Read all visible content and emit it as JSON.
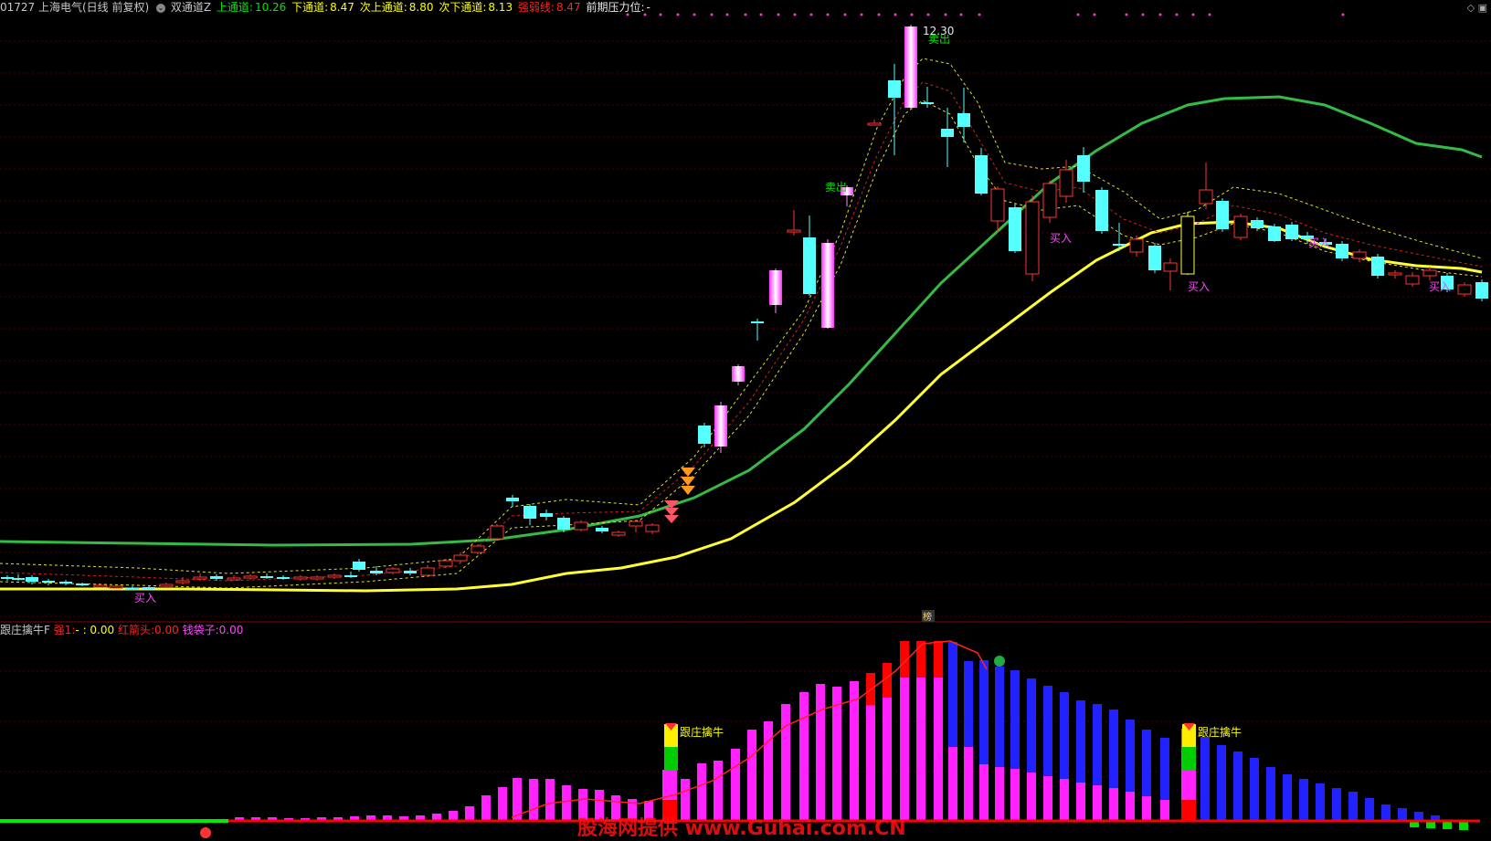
{
  "header": {
    "code_title": "01727 上海电气(日线 前复权)",
    "indicator_name": "双通道Z",
    "up_channel_label": "上通道:",
    "up_channel_value": "10.26",
    "down_channel_label": "下通道:",
    "down_channel_value": "8.47",
    "sub_up_channel_label": "次上通道:",
    "sub_up_channel_value": "8.80",
    "sub_down_channel_label": "次下通道:",
    "sub_down_channel_value": "8.13",
    "strong_weak_label": "强弱线:",
    "strong_weak_value": "8.47",
    "prev_pressure_label": "前期压力位:",
    "prev_pressure_value": "-"
  },
  "sub_panel": {
    "indicator_name": "跟庄擒牛F",
    "strong_label": "强1:",
    "strong_value": "- : 0.00",
    "red_arrow_label": "红箭头:",
    "red_arrow_value": "0.00",
    "bag_label": "钱袋子:",
    "bag_value": "0.00",
    "tag_left": "跟庄擒牛",
    "tag_right": "跟庄擒牛",
    "divider_badge": "榜"
  },
  "main_chart": {
    "high_label": "12.30",
    "sell_labels": [
      "卖出",
      "卖出"
    ],
    "buy_labels": [
      "买入",
      "买入",
      "买入",
      "买入",
      "买入"
    ]
  },
  "watermark": "股海网提供 www.Guhai.com.CN",
  "colors": {
    "background": "#000000",
    "grid": "#5a0000",
    "up_candle": "#ff3333",
    "down_candle": "#55ffff",
    "green_line": "#33bb44",
    "yellow_line": "#ffff33",
    "bar_magenta": "#ff22ff",
    "bar_blue": "#2222ff",
    "bar_red": "#ff0000"
  },
  "icons": [
    "dropdown-icon",
    "corner-diamond-icon",
    "corner-window-icon"
  ]
}
